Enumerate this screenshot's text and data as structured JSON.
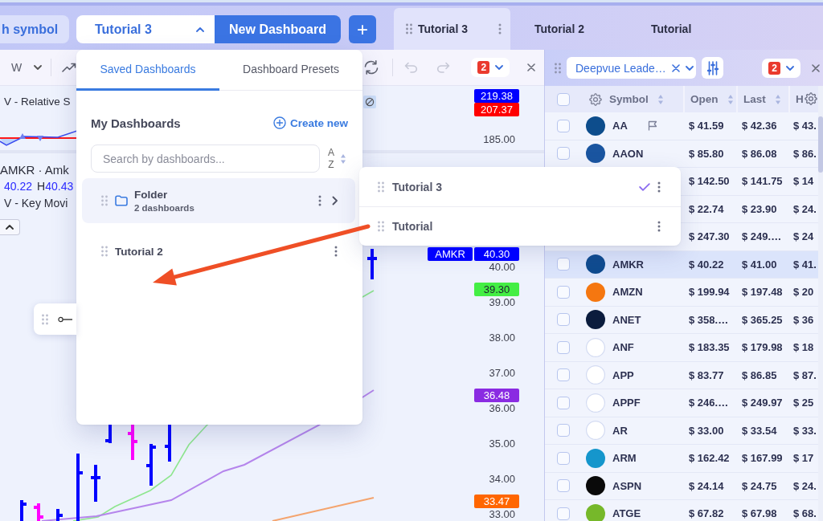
{
  "header": {
    "symbol_search": "h symbol",
    "dashboard_select": {
      "value": "Tutorial 3",
      "expanded": true
    },
    "new_dashboard_button": "New Dashboard",
    "add_button": "+",
    "tabs": [
      {
        "label": "Tutorial 3",
        "selected": true
      },
      {
        "label": "Tutorial 2",
        "selected": false
      },
      {
        "label": "Tutorial",
        "selected": false
      }
    ]
  },
  "chart_toolbar": {
    "interval": "W",
    "undo": {
      "disabled": true
    },
    "redo": {
      "disabled": true
    },
    "link_group": "2"
  },
  "watchlist_toolbar": {
    "list_select": "Deepvue Leade…",
    "link_group": "2"
  },
  "chart": {
    "indicator_pane": {
      "legend": "V - Relative S",
      "axis_badges": [
        {
          "text": "219.38",
          "color": "#0000ff"
        },
        {
          "text": "207.37",
          "color": "#ff0000"
        }
      ],
      "axis_ticks": [
        "185.00"
      ]
    },
    "price_pane": {
      "title": "AMKR · Amk",
      "ohlc": [
        {
          "value": "40.22"
        },
        {
          "label": "H",
          "value": "40.43"
        }
      ],
      "indicator_legend": "V - Key Movi",
      "axis": [
        {
          "tick": "40.00",
          "badges": [
            {
              "text": "AMKR",
              "color": "#0000ff"
            },
            {
              "text": "40.30",
              "color": "#0000ff"
            }
          ]
        },
        {
          "tick": "39.00",
          "badges": [
            {
              "text": "39.30",
              "color": "#44ee44"
            }
          ]
        },
        {
          "tick": "38.00"
        },
        {
          "tick": "37.00"
        },
        {
          "tick": "36.00",
          "badges": [
            {
              "text": "36.48",
              "color": "#8a2be2"
            }
          ]
        },
        {
          "tick": "35.00"
        },
        {
          "tick": "34.00"
        },
        {
          "tick": "33.00",
          "badges": [
            {
              "text": "33.47",
              "color": "#ff6600"
            }
          ]
        }
      ]
    }
  },
  "dashboard_menu": {
    "tabs": [
      {
        "label": "Saved Dashboards",
        "selected": true
      },
      {
        "label": "Dashboard Presets",
        "selected": false
      }
    ],
    "heading": "My Dashboards",
    "create_link": "Create new",
    "search": {
      "placeholder": "Search by dashboards..."
    },
    "sort": {
      "from": "A",
      "to": "Z"
    },
    "items": [
      {
        "kind": "folder",
        "name": "Folder",
        "subtitle": "2 dashboards",
        "selected": true,
        "expanded": true,
        "children": [
          {
            "name": "Tutorial 3",
            "selected": true
          },
          {
            "name": "Tutorial",
            "selected": false
          }
        ]
      },
      {
        "kind": "dashboard",
        "name": "Tutorial 2",
        "selected": false
      }
    ]
  },
  "table": {
    "select_all": {
      "checked": false
    },
    "columns": [
      {
        "label": "Symbol",
        "sortable": true
      },
      {
        "label": "Open",
        "sortable": true
      },
      {
        "label": "Last",
        "sortable": true
      },
      {
        "label": "H",
        "sortable": false
      }
    ],
    "rows": [
      {
        "checked": false,
        "color": "#0d4d8c",
        "symbol": "AA",
        "flagged": true,
        "selected": false,
        "open": "$ 41.59",
        "last": "$ 42.36",
        "h": "$ 43."
      },
      {
        "checked": false,
        "color": "#1a55a0",
        "symbol": "AAON",
        "flagged": false,
        "selected": false,
        "open": "$ 85.80",
        "last": "$ 86.08",
        "h": "$ 86."
      },
      {
        "selected": false,
        "open": "$ 142.50",
        "last": "$ 141.75",
        "h": "$ 14"
      },
      {
        "selected": false,
        "open": "$ 22.74",
        "last": "$ 23.90",
        "h": "$ 24."
      },
      {
        "selected": false,
        "open": "$ 247.30",
        "last": "$ 249.…",
        "h": "$ 24"
      },
      {
        "checked": false,
        "color": "#0f4b8f",
        "symbol": "AMKR",
        "flagged": false,
        "selected": true,
        "open": "$ 40.22",
        "last": "$ 41.00",
        "h": "$ 41."
      },
      {
        "checked": false,
        "color": "#f57710",
        "symbol": "AMZN",
        "flagged": false,
        "selected": false,
        "open": "$ 199.94",
        "last": "$ 197.48",
        "h": "$ 20"
      },
      {
        "checked": false,
        "color": "#0b1c3d",
        "symbol": "ANET",
        "flagged": false,
        "selected": false,
        "open": "$ 358.…",
        "last": "$ 365.25",
        "h": "$ 36"
      },
      {
        "checked": false,
        "color": "#ffffff",
        "symbol": "ANF",
        "flagged": false,
        "selected": false,
        "open": "$ 183.35",
        "last": "$ 179.98",
        "h": "$ 18"
      },
      {
        "checked": false,
        "color": "#ffffff",
        "symbol": "APP",
        "flagged": false,
        "selected": false,
        "open": "$ 83.77",
        "last": "$ 86.85",
        "h": "$ 87."
      },
      {
        "checked": false,
        "color": "#ffffff",
        "symbol": "APPF",
        "flagged": false,
        "selected": false,
        "open": "$ 246.…",
        "last": "$ 249.97",
        "h": "$ 25"
      },
      {
        "checked": false,
        "color": "#ffffff",
        "symbol": "AR",
        "flagged": false,
        "selected": false,
        "open": "$ 33.00",
        "last": "$ 33.54",
        "h": "$ 33."
      },
      {
        "checked": false,
        "color": "#1596cc",
        "symbol": "ARM",
        "flagged": false,
        "selected": false,
        "open": "$ 162.42",
        "last": "$ 167.99",
        "h": "$ 17"
      },
      {
        "checked": false,
        "color": "#0a0a0a",
        "symbol": "ASPN",
        "flagged": false,
        "selected": false,
        "open": "$ 24.14",
        "last": "$ 24.75",
        "h": "$ 24."
      },
      {
        "checked": false,
        "color": "#76b82a",
        "symbol": "ATGE",
        "flagged": false,
        "selected": false,
        "open": "$ 67.82",
        "last": "$ 67.98",
        "h": "$ 68."
      }
    ]
  }
}
